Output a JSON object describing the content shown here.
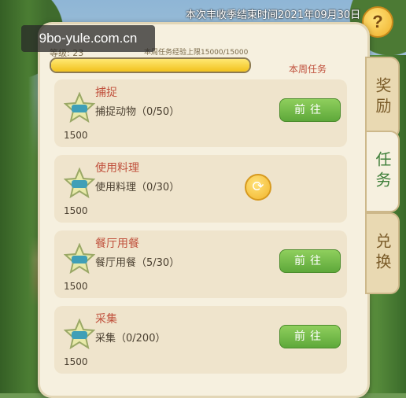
{
  "season_end": "本次丰收季结束时间2021年09月30日",
  "watermark": "9bo-yule.com.cn",
  "help_icon_text": "?",
  "header": {
    "level_label": "等级: 23",
    "exp_cap": "本周任务经验上限15000/15000",
    "exp_progress": 1.0,
    "weekly_label": "本周任务"
  },
  "tasks": [
    {
      "title": "捕捉",
      "desc": "捕捉动物（0/50）",
      "reward": "1500",
      "action": "前往",
      "action_type": "go"
    },
    {
      "title": "使用料理",
      "desc": "使用料理（0/30）",
      "reward": "1500",
      "action": "",
      "action_type": "refresh"
    },
    {
      "title": "餐厅用餐",
      "desc": "餐厅用餐（5/30）",
      "reward": "1500",
      "action": "前往",
      "action_type": "go"
    },
    {
      "title": "采集",
      "desc": "采集（0/200）",
      "reward": "1500",
      "action": "前往",
      "action_type": "go"
    }
  ],
  "tabs": [
    {
      "label": "奖励",
      "active": false
    },
    {
      "label": "任务",
      "active": true
    },
    {
      "label": "兑换",
      "active": false
    }
  ],
  "colors": {
    "accent_red": "#c0513d",
    "button_green": "#5ea83a",
    "panel_bg": "#f6f0df"
  },
  "icons": {
    "badge": "exp-star-badge-icon",
    "refresh": "refresh-icon",
    "help": "question-icon"
  }
}
